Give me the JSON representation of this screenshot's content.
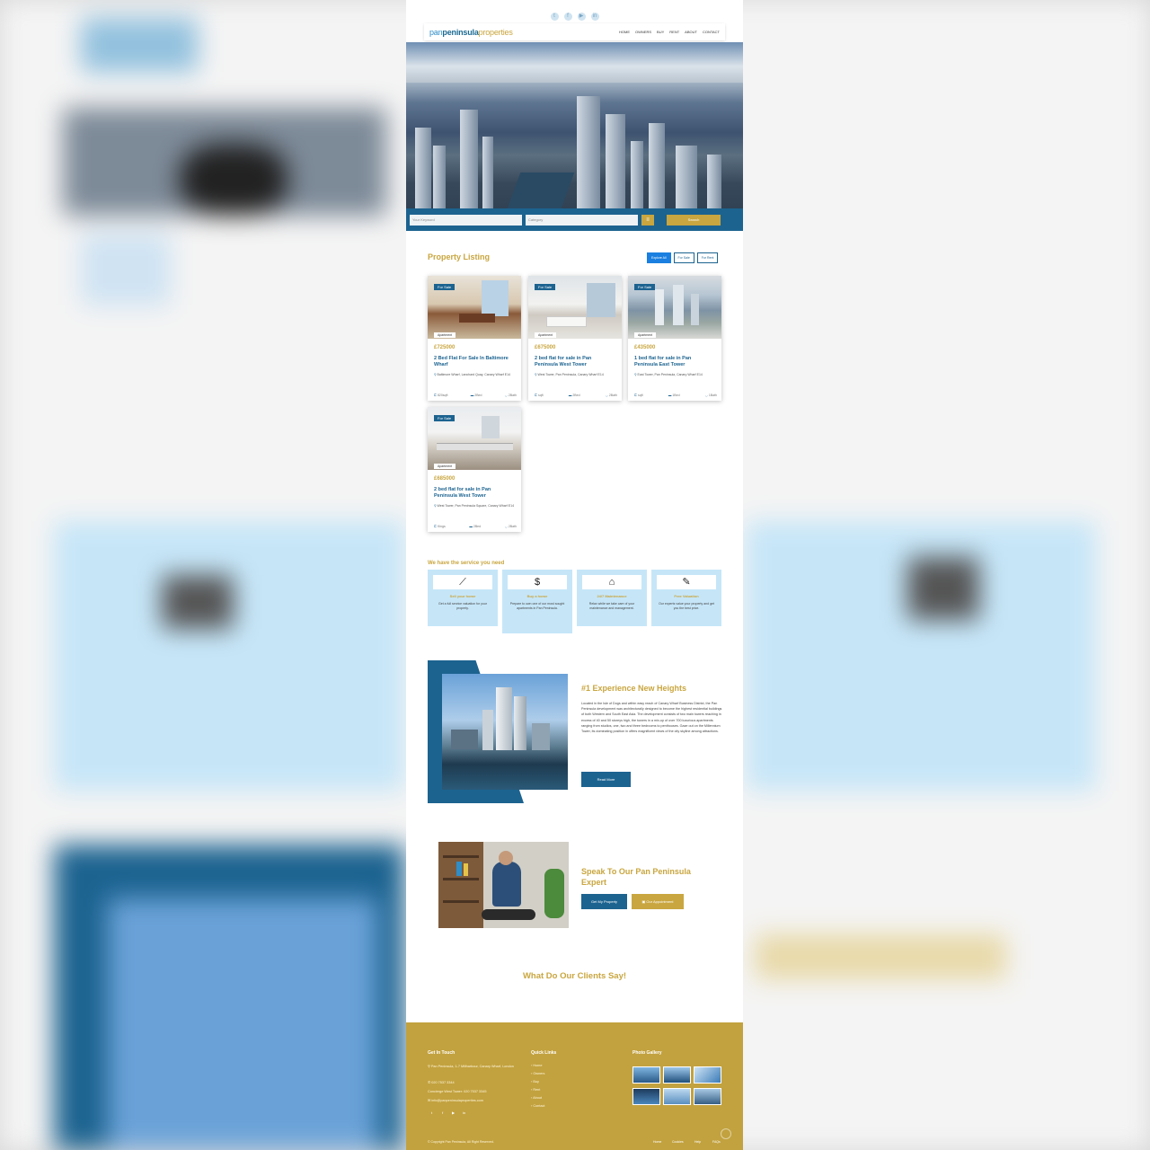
{
  "top_social_icons": [
    "twitter-icon",
    "facebook-icon",
    "youtube-icon",
    "linkedin-icon"
  ],
  "brand": {
    "part1": "pan",
    "part2": "peninsula",
    "part3": "properties"
  },
  "nav": [
    "HOME",
    "OWNERS",
    "BUY",
    "RENT",
    "ABOUT",
    "CONTACT"
  ],
  "search": {
    "keyword_placeholder": "Your Keyword",
    "category_placeholder": "Category",
    "button": "Search"
  },
  "listing": {
    "title": "Property Listing",
    "filters": [
      "Explore All",
      "For Sale",
      "For Rent"
    ],
    "cards": [
      {
        "badge": "For Sale",
        "category": "Apartment",
        "price": "£725000",
        "title": "2 Bed Flat For Sale In Baltimore Wharf",
        "address": "Baltimore Wharf, Lanchard Quay, Canary Wharf E14",
        "meta": [
          "820sqft",
          "2Bed",
          "2Bath"
        ]
      },
      {
        "badge": "For Sale",
        "category": "Apartment",
        "price": "£675000",
        "title": "2 bed flat for sale in Pan Peninsula West Tower",
        "address": "West Tower, Pan Peninsula, Canary Wharf E14",
        "meta": [
          "sqft",
          "2Bed",
          "2Bath"
        ]
      },
      {
        "badge": "For Sale",
        "category": "Apartment",
        "price": "£435000",
        "title": "1 bed flat for sale in Pan Peninsula East Tower",
        "address": "East Tower, Pan Peninsula, Canary Wharf E14",
        "meta": [
          "sqft",
          "1Bed",
          "1Bath"
        ]
      },
      {
        "badge": "For Sale",
        "category": "Apartment",
        "price": "£685000",
        "title": "2 bed flat for sale in Pan Peninsula West Tower",
        "address": "West Tower, Pan Peninsula Square, Canary Wharf E14",
        "meta": [
          "Kings",
          "2Bed",
          "2Bath"
        ]
      }
    ]
  },
  "services": {
    "title": "We have the service you need",
    "items": [
      {
        "icon": "chart-line-icon",
        "title": "Sell your home",
        "desc": "Get a full service valuation for your property."
      },
      {
        "icon": "dollar-document-icon",
        "title": "Buy a home",
        "desc": "Prepare to own one of our most sought apartments in Pan Peninsula."
      },
      {
        "icon": "home-icon",
        "title": "24/7 Maintenance",
        "desc": "Relax while we take care of your maintenance and management."
      },
      {
        "icon": "signature-document-icon",
        "title": "Free Valuation",
        "desc": "Our experts value your property and get you the best price."
      }
    ]
  },
  "experience": {
    "title": "#1 Experience New Heights",
    "text": "Located in the Isle of Dogs and within easy reach of Canary Wharf Business District, the Pan Peninsula development was architecturally designed to become the highest residential buildings of both Western and South East Asia. The development consists of two main towers reaching in excess of 40 and 50 storeys high, the towers in a mix-up of over 700 luxurious apartments ranging from studios, one, two and three bedrooms to penthouses. Gaze out on the Millennium Tower, its dominating position in offers magnificent views of the city skyline among attractions.",
    "button": "Read More"
  },
  "speak": {
    "title": "Speak To Our Pan Peninsula Expert",
    "button1": "Get My Property",
    "button2": "Our Appointment"
  },
  "clients_title": "What Do Our Clients Say!",
  "footer": {
    "col1_title": "Get In Touch",
    "address": "Pan Peninsula, 1-7 Millharbour, Canary Wharf, London",
    "phone": "020 7537 3344",
    "concierge": "Concierge West Tower: 020 7537 3345",
    "email": "info@panpeninsulaproperties.com",
    "col2_title": "Quick Links",
    "links": [
      "Home",
      "Owners",
      "Buy",
      "Rent",
      "About",
      "Contact"
    ],
    "col3_title": "Photo Gallery",
    "copyright": "© Copyright Pan Peninsula, All Right Reserved.",
    "bottom_nav": [
      "Home",
      "Cookies",
      "Help",
      "FAQs"
    ]
  },
  "colors": {
    "gold": "#c9a63f",
    "blue": "#1c6390",
    "light_blue": "#c6e6f8",
    "footer": "#c2a23f"
  }
}
